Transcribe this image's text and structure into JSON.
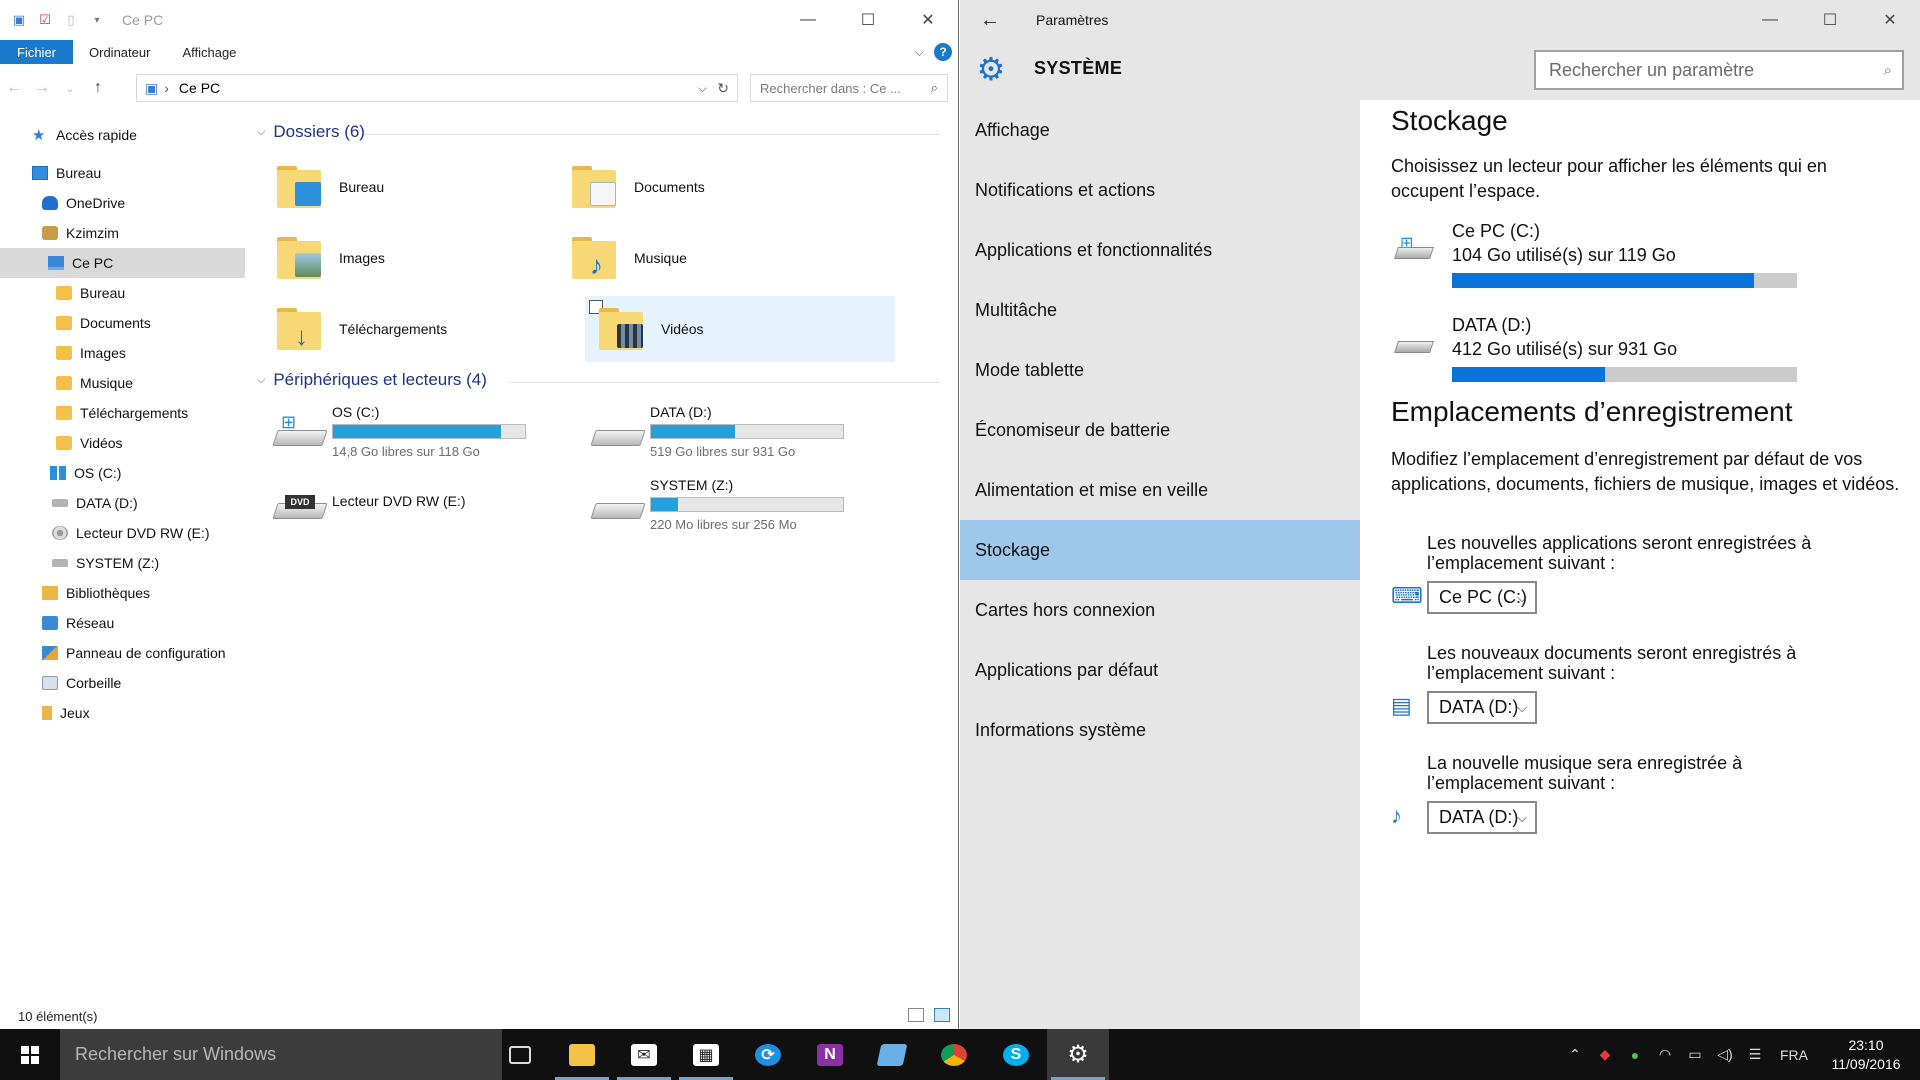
{
  "explorer": {
    "title": "Ce PC",
    "ribbon_tabs": [
      "Fichier",
      "Ordinateur",
      "Affichage"
    ],
    "help": "?",
    "address": "Ce PC",
    "search_placeholder": "Rechercher dans : Ce ...",
    "nav_items": [
      {
        "label": "Accès rapide",
        "icon": "star-icon",
        "indent": 0
      },
      {
        "label": "Bureau",
        "icon": "desktop-icon",
        "indent": 0
      },
      {
        "label": "OneDrive",
        "icon": "cloud-icon",
        "indent": 1
      },
      {
        "label": "Kzimzim",
        "icon": "user-icon",
        "indent": 1
      },
      {
        "label": "Ce PC",
        "icon": "pc-icon",
        "indent": 1
      },
      {
        "label": "Bureau",
        "icon": "folder-icon",
        "indent": 2
      },
      {
        "label": "Documents",
        "icon": "folder-icon",
        "indent": 2
      },
      {
        "label": "Images",
        "icon": "folder-icon",
        "indent": 2
      },
      {
        "label": "Musique",
        "icon": "folder-icon",
        "indent": 2
      },
      {
        "label": "Téléchargements",
        "icon": "folder-icon",
        "indent": 2
      },
      {
        "label": "Vidéos",
        "icon": "folder-icon",
        "indent": 2
      },
      {
        "label": "OS (C:)",
        "icon": "windows-drive-icon",
        "indent": 2
      },
      {
        "label": "DATA (D:)",
        "icon": "drive-icon",
        "indent": 2
      },
      {
        "label": "Lecteur DVD RW (E:)",
        "icon": "dvd-icon",
        "indent": 2
      },
      {
        "label": "SYSTEM (Z:)",
        "icon": "drive-icon",
        "indent": 2
      },
      {
        "label": "Bibliothèques",
        "icon": "library-icon",
        "indent": 1
      },
      {
        "label": "Réseau",
        "icon": "network-icon",
        "indent": 1
      },
      {
        "label": "Panneau de configuration",
        "icon": "control-panel-icon",
        "indent": 1
      },
      {
        "label": "Corbeille",
        "icon": "recycle-bin-icon",
        "indent": 1
      },
      {
        "label": "Jeux",
        "icon": "games-folder-icon",
        "indent": 1
      }
    ],
    "folders_group": "Dossiers (6)",
    "folders": [
      "Bureau",
      "Documents",
      "Images",
      "Musique",
      "Téléchargements",
      "Vidéos"
    ],
    "drives_group": "Périphériques et lecteurs (4)",
    "drives": [
      {
        "name": "OS (C:)",
        "free": "14,8 Go libres sur 118 Go",
        "used_fraction": 0.875
      },
      {
        "name": "DATA (D:)",
        "free": "519 Go libres sur 931 Go",
        "used_fraction": 0.44
      },
      {
        "name": "Lecteur DVD RW (E:)",
        "free": "",
        "used_fraction": null
      },
      {
        "name": "SYSTEM (Z:)",
        "free": "220 Mo libres sur 256 Mo",
        "used_fraction": 0.14
      }
    ],
    "status": "10 élément(s)"
  },
  "settings": {
    "title": "Paramètres",
    "section": "SYSTÈME",
    "search_placeholder": "Rechercher un paramètre",
    "menu": [
      "Affichage",
      "Notifications et actions",
      "Applications et fonctionnalités",
      "Multitâche",
      "Mode tablette",
      "Économiseur de batterie",
      "Alimentation et mise en veille",
      "Stockage",
      "Cartes hors connexion",
      "Applications par défaut",
      "Informations système"
    ],
    "selected_menu": "Stockage",
    "storage_title": "Stockage",
    "storage_desc": "Choisissez un lecteur pour afficher les éléments qui en occupent l’espace.",
    "drives": [
      {
        "name": "Ce PC (C:)",
        "usage": "104 Go utilisé(s) sur 119 Go",
        "used_fraction": 0.874
      },
      {
        "name": "DATA (D:)",
        "usage": "412 Go utilisé(s) sur 931 Go",
        "used_fraction": 0.443
      }
    ],
    "save_title": "Emplacements d’enregistrement",
    "save_desc": "Modifiez l’emplacement d’enregistrement par défaut de vos applications, documents, fichiers de musique, images et vidéos.",
    "save_rows": [
      {
        "label": "Les nouvelles applications seront enregistrées à l’emplacement suivant :",
        "value": "Ce PC (C:)",
        "icon": "apps-icon"
      },
      {
        "label": "Les nouveaux documents seront enregistrés à l’emplacement suivant :",
        "value": "DATA (D:)",
        "icon": "documents-icon"
      },
      {
        "label": "La nouvelle musique sera enregistrée à l’emplacement suivant :",
        "value": "DATA (D:)",
        "icon": "music-icon"
      }
    ]
  },
  "taskbar": {
    "search_placeholder": "Rechercher sur Windows",
    "language": "FRA",
    "time": "23:10",
    "date": "11/09/2016"
  }
}
